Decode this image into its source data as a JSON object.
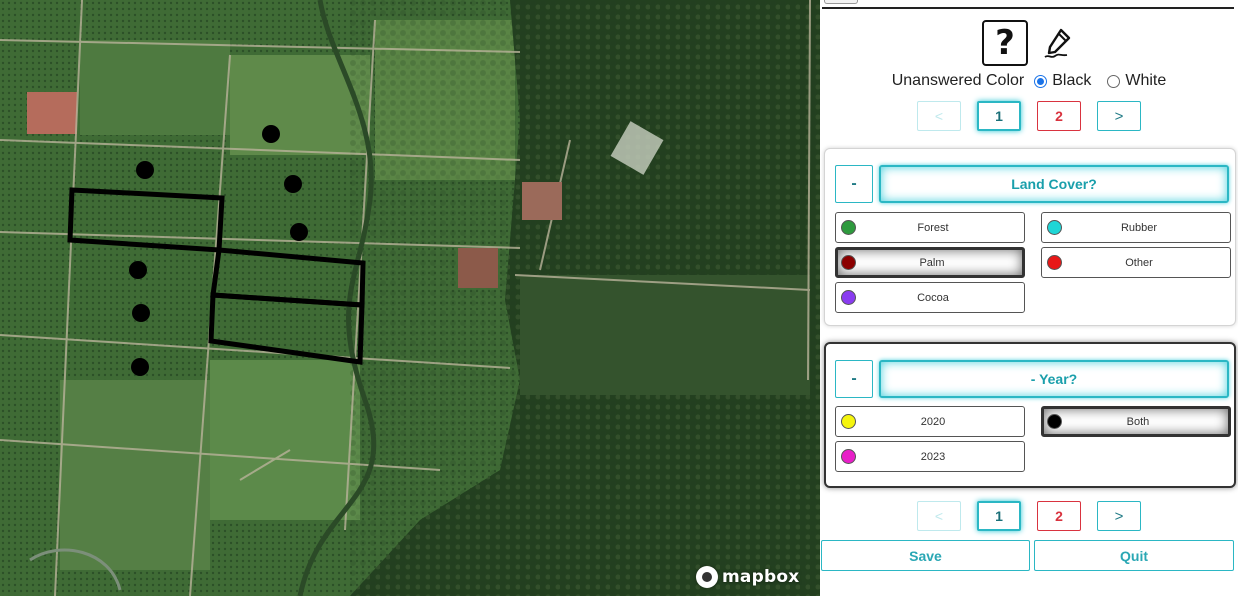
{
  "map": {
    "attribution": "mapbox"
  },
  "panel": {
    "help_glyph": "?",
    "unanswered_color": {
      "label": "Unanswered Color",
      "options": [
        {
          "label": "Black",
          "checked": true
        },
        {
          "label": "White",
          "checked": false
        }
      ]
    },
    "pager": {
      "prev": "<",
      "next": ">",
      "pages": [
        "1",
        "2"
      ],
      "current": "1"
    },
    "questions": [
      {
        "collapse_label": "-",
        "title": "Land Cover?",
        "options": [
          {
            "label": "Forest",
            "color": "#2e9a3e",
            "selected": false
          },
          {
            "label": "Rubber",
            "color": "#1fd6d6",
            "selected": false
          },
          {
            "label": "Palm",
            "color": "#8b0000",
            "selected": true
          },
          {
            "label": "Other",
            "color": "#e81818",
            "selected": false
          },
          {
            "label": "Cocoa",
            "color": "#8a3cf0",
            "selected": false
          }
        ]
      },
      {
        "collapse_label": "-",
        "title": "- Year?",
        "options": [
          {
            "label": "2020",
            "color": "#f5f50e",
            "selected": false
          },
          {
            "label": "Both",
            "color": "#000000",
            "selected": true
          },
          {
            "label": "2023",
            "color": "#e81fc8",
            "selected": false
          }
        ]
      }
    ],
    "actions": {
      "save": "Save",
      "quit": "Quit"
    }
  },
  "colors": {
    "accent": "#2bb7c4",
    "pending_page": "#d9333f"
  }
}
